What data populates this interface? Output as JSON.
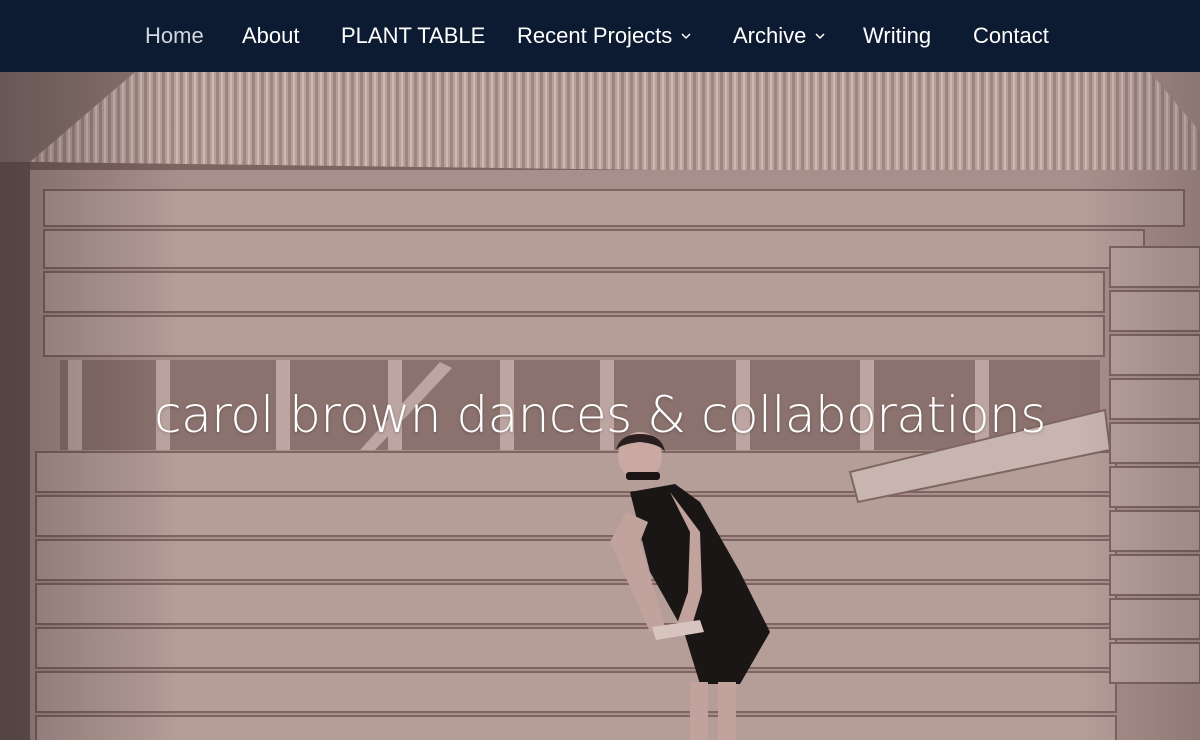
{
  "nav": {
    "items": [
      {
        "label": "Home",
        "active": true,
        "has_dropdown": false
      },
      {
        "label": "About",
        "active": false,
        "has_dropdown": false
      },
      {
        "label": "PLANT TABLE",
        "active": false,
        "has_dropdown": false
      },
      {
        "label": "Recent Projects",
        "active": false,
        "has_dropdown": true
      },
      {
        "label": "Archive",
        "active": false,
        "has_dropdown": true
      },
      {
        "label": "Writing",
        "active": false,
        "has_dropdown": false
      },
      {
        "label": "Contact",
        "active": false,
        "has_dropdown": false
      }
    ],
    "dropdown_icon": "chevron-down-icon"
  },
  "hero": {
    "title": "carol brown dances & collaborations",
    "image_subject": "woman in black dress and sunglasses posing in front of weathered wooden shed with corrugated roof"
  },
  "colors": {
    "nav_background": "#0c1b31",
    "nav_text": "#ffffff",
    "nav_active_text": "#d3d6dc",
    "hero_title": "#ffffff"
  }
}
